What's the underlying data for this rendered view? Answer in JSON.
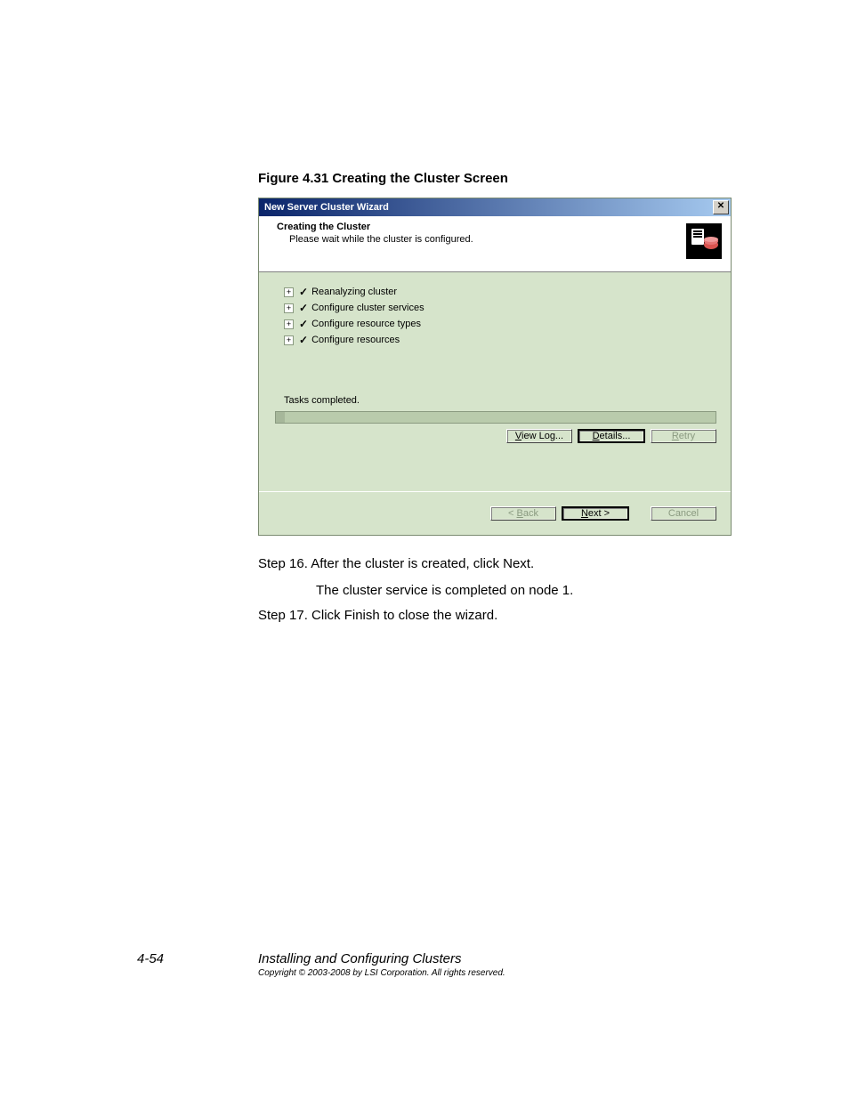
{
  "figure_caption": "Figure 4.31   Creating the Cluster Screen",
  "wizard": {
    "title": "New Server Cluster Wizard",
    "header": {
      "title": "Creating the Cluster",
      "subtitle": "Please wait while the cluster is configured."
    },
    "tasks": [
      {
        "label": "Reanalyzing cluster"
      },
      {
        "label": "Configure cluster services"
      },
      {
        "label": "Configure resource types"
      },
      {
        "label": "Configure resources"
      }
    ],
    "status_text": "Tasks completed.",
    "buttons": {
      "view_log": "View Log...",
      "details": "Details...",
      "retry": "Retry",
      "back": "< Back",
      "next": "Next >",
      "cancel": "Cancel"
    }
  },
  "body": {
    "step16": "Step 16. After the cluster is created, click Next.",
    "step16_note": "The cluster service is completed on node 1.",
    "step17": "Step 17. Click Finish to close the wizard."
  },
  "footer": {
    "page_number": "4-54",
    "doc_title": "Installing and Configuring Clusters",
    "copyright": "Copyright © 2003-2008 by LSI Corporation. All rights reserved."
  }
}
